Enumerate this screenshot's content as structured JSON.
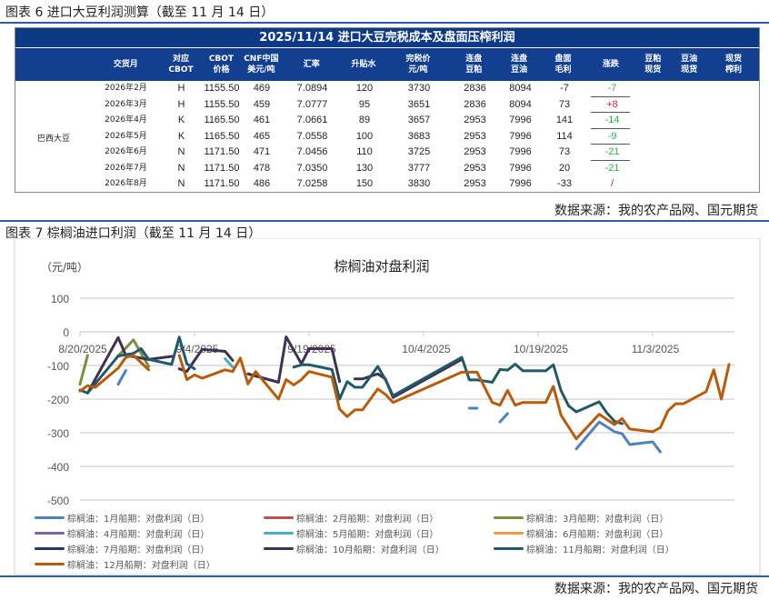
{
  "table_section": {
    "title": "图表 6 进口大豆利润测算（截至 11 月 14 日）",
    "source": "数据来源：我的农产品网、国元期货"
  },
  "table": {
    "title": "2025/11/14 进口大豆完税成本及盘面压榨利润",
    "headers": [
      "",
      "交货月",
      "对应\nCBOT",
      "CBOT\n价格",
      "CNF中国\n美元/吨",
      "汇率",
      "升贴水",
      "完税价\n元/吨",
      "连盘\n豆粕",
      "连盘\n豆油",
      "盘面\n毛利",
      "涨跌",
      "豆粕\n现货",
      "豆油\n现货",
      "现货\n榨利"
    ],
    "row_label": "巴西大豆",
    "rows": [
      {
        "month": "2026年2月",
        "cbot": "H",
        "price": "1155.50",
        "cnf": "469",
        "fx": "7.0894",
        "basis": "120",
        "duty": "3730",
        "meal": "2836",
        "oil": "8094",
        "margin": "-7",
        "change": "-7",
        "dir": "down"
      },
      {
        "month": "2026年3月",
        "cbot": "H",
        "price": "1155.50",
        "cnf": "459",
        "fx": "7.0777",
        "basis": "95",
        "duty": "3651",
        "meal": "2836",
        "oil": "8094",
        "margin": "73",
        "change": "+8",
        "dir": "up"
      },
      {
        "month": "2026年4月",
        "cbot": "K",
        "price": "1165.50",
        "cnf": "461",
        "fx": "7.0661",
        "basis": "89",
        "duty": "3657",
        "meal": "2953",
        "oil": "7996",
        "margin": "141",
        "change": "-14",
        "dir": "down"
      },
      {
        "month": "2026年5月",
        "cbot": "K",
        "price": "1165.50",
        "cnf": "465",
        "fx": "7.0558",
        "basis": "100",
        "duty": "3683",
        "meal": "2953",
        "oil": "7996",
        "margin": "114",
        "change": "-9",
        "dir": "down"
      },
      {
        "month": "2026年6月",
        "cbot": "N",
        "price": "1171.50",
        "cnf": "471",
        "fx": "7.0456",
        "basis": "110",
        "duty": "3725",
        "meal": "2953",
        "oil": "7996",
        "margin": "73",
        "change": "-21",
        "dir": "down"
      },
      {
        "month": "2026年7月",
        "cbot": "N",
        "price": "1171.50",
        "cnf": "478",
        "fx": "7.0350",
        "basis": "130",
        "duty": "3777",
        "meal": "2953",
        "oil": "7996",
        "margin": "20",
        "change": "-21",
        "dir": "down"
      },
      {
        "month": "2026年8月",
        "cbot": "N",
        "price": "1171.50",
        "cnf": "486",
        "fx": "7.0258",
        "basis": "150",
        "duty": "3830",
        "meal": "2953",
        "oil": "7996",
        "margin": "-33",
        "change": "/",
        "dir": "up"
      }
    ],
    "colors": {
      "up": "#E8202A",
      "down": "#2BB04A",
      "header": "#123F8F"
    }
  },
  "chart_section": {
    "title": "图表 7 棕榈油进口利润（截至 11 月 14 日）",
    "source": "数据来源：我的农产品网、国元期货"
  },
  "chart_data": {
    "type": "line",
    "title": "棕榈油对盘利润",
    "ylabel": "（元/吨）",
    "ylim": [
      -500,
      100
    ],
    "yticks": [
      "100",
      "0",
      "-100",
      "-200",
      "-300",
      "-400",
      "-500"
    ],
    "x_unit": "trading day index from 8/20/2025",
    "xlim": [
      0,
      86
    ],
    "xticks": [
      {
        "day": 0,
        "label": "8/20/2025"
      },
      {
        "day": 15,
        "label": "9/4/2025"
      },
      {
        "day": 30,
        "label": "9/19/2025"
      },
      {
        "day": 45,
        "label": "10/4/2025"
      },
      {
        "day": 60,
        "label": "10/19/2025"
      },
      {
        "day": 75,
        "label": "11/3/2025"
      }
    ],
    "grid": true,
    "legend_position": "bottom",
    "series": [
      {
        "name": "棕榈油：1月船期：对盘利润（日）",
        "color": "#4F81BD",
        "segments": [
          [
            [
              5,
              -156
            ],
            [
              6,
              -115
            ]
          ],
          [
            [
              51,
              -227
            ],
            [
              52,
              -227
            ]
          ],
          [
            [
              55,
              -268
            ],
            [
              56,
              -243
            ]
          ],
          [
            [
              65,
              -348
            ],
            [
              68,
              -268
            ],
            [
              70,
              -297
            ],
            [
              71,
              -303
            ],
            [
              72,
              -335
            ],
            [
              75,
              -327
            ],
            [
              76,
              -357
            ]
          ]
        ]
      },
      {
        "name": "棕榈油：2月船期：对盘利润（日）",
        "color": "#C0504D",
        "segments": []
      },
      {
        "name": "棕榈油：3月船期：对盘利润（日）",
        "color": "#76923C",
        "segments": [
          [
            [
              0,
              -156
            ],
            [
              1,
              -70
            ]
          ],
          [
            [
              5,
              -72
            ],
            [
              7,
              -24
            ],
            [
              9,
              -103
            ]
          ]
        ]
      },
      {
        "name": "棕榈油：4月船期：对盘利润（日）",
        "color": "#8064A2",
        "segments": []
      },
      {
        "name": "棕榈油：5月船期：对盘利润（日）",
        "color": "#4BACC6",
        "segments": [
          [
            [
              19,
              -80
            ],
            [
              20,
              -105
            ]
          ]
        ]
      },
      {
        "name": "棕榈油：6月船期：对盘利润（日）",
        "color": "#F79646",
        "segments": []
      },
      {
        "name": "棕榈油：7月船期：对盘利润（日）",
        "color": "#1F3864",
        "segments": []
      },
      {
        "name": "棕榈油：10月船期：对盘利润（日）",
        "color": "#403152",
        "segments": [
          [
            [
              1,
              -182
            ],
            [
              5,
              -17
            ],
            [
              6,
              -70
            ],
            [
              9,
              -82
            ],
            [
              12,
              -73
            ]
          ],
          [
            [
              13,
              -110
            ],
            [
              14,
              -118
            ],
            [
              16,
              -52
            ],
            [
              19,
              -58
            ],
            [
              20,
              -85
            ]
          ],
          [
            [
              22,
              -125
            ],
            [
              26,
              -150
            ],
            [
              27,
              -15
            ],
            [
              29,
              -95
            ],
            [
              30,
              -50
            ],
            [
              33,
              -50
            ],
            [
              34,
              -148
            ]
          ],
          [
            [
              36,
              -140
            ],
            [
              37,
              -140
            ],
            [
              39,
              -125
            ],
            [
              40,
              -140
            ],
            [
              41,
              -195
            ],
            [
              50,
              -82
            ]
          ]
        ]
      },
      {
        "name": "棕榈油：11月船期：对盘利润（日）",
        "color": "#215968",
        "segments": [
          [
            [
              0,
              -173
            ],
            [
              1,
              -182
            ],
            [
              5,
              -72
            ],
            [
              7,
              -64
            ],
            [
              8,
              -50
            ],
            [
              9,
              -82
            ],
            [
              12,
              -97
            ],
            [
              13,
              -16
            ],
            [
              14,
              -95
            ],
            [
              15,
              -110
            ]
          ],
          [
            [
              28,
              -105
            ],
            [
              29,
              -98
            ],
            [
              30,
              -98
            ],
            [
              33,
              -112
            ],
            [
              34,
              -200
            ],
            [
              35,
              -148
            ],
            [
              36,
              -165
            ],
            [
              37,
              -165
            ],
            [
              39,
              -103
            ],
            [
              40,
              -142
            ],
            [
              41,
              -190
            ],
            [
              50,
              -76
            ],
            [
              51,
              -143
            ],
            [
              52,
              -143
            ],
            [
              54,
              -150
            ],
            [
              55,
              -112
            ],
            [
              56,
              -114
            ],
            [
              57,
              -96
            ],
            [
              58,
              -116
            ],
            [
              61,
              -116
            ],
            [
              62,
              -98
            ],
            [
              63,
              -175
            ],
            [
              64,
              -220
            ],
            [
              65,
              -238
            ],
            [
              68,
              -208
            ],
            [
              69,
              -241
            ],
            [
              70,
              -266
            ],
            [
              71,
              -273
            ]
          ]
        ]
      },
      {
        "name": "棕榈油：12月船期：对盘利润（日）",
        "color": "#B85C0B",
        "segments": [
          [
            [
              0,
              -176
            ],
            [
              1,
              -160
            ],
            [
              2,
              -165
            ],
            [
              5,
              -108
            ],
            [
              6,
              -76
            ],
            [
              7,
              -70
            ],
            [
              9,
              -113
            ]
          ],
          [
            [
              13,
              -70
            ],
            [
              14,
              -142
            ],
            [
              15,
              -128
            ],
            [
              16,
              -138
            ],
            [
              19,
              -113
            ],
            [
              20,
              -118
            ],
            [
              21,
              -78
            ],
            [
              22,
              -155
            ],
            [
              23,
              -118
            ],
            [
              26,
              -200
            ],
            [
              27,
              -142
            ],
            [
              28,
              -158
            ],
            [
              29,
              -142
            ],
            [
              30,
              -118
            ],
            [
              33,
              -135
            ],
            [
              34,
              -230
            ],
            [
              35,
              -252
            ],
            [
              36,
              -232
            ],
            [
              37,
              -232
            ],
            [
              39,
              -170
            ],
            [
              40,
              -186
            ],
            [
              41,
              -210
            ],
            [
              50,
              -120
            ],
            [
              52,
              -120
            ],
            [
              54,
              -210
            ],
            [
              55,
              -218
            ],
            [
              56,
              -174
            ],
            [
              57,
              -218
            ],
            [
              58,
              -210
            ],
            [
              61,
              -210
            ],
            [
              62,
              -162
            ],
            [
              63,
              -248
            ],
            [
              65,
              -318
            ],
            [
              68,
              -245
            ],
            [
              70,
              -276
            ],
            [
              71,
              -258
            ],
            [
              72,
              -289
            ],
            [
              75,
              -297
            ],
            [
              76,
              -285
            ],
            [
              77,
              -235
            ],
            [
              78,
              -214
            ],
            [
              79,
              -214
            ],
            [
              82,
              -178
            ],
            [
              83,
              -113
            ],
            [
              84,
              -200
            ],
            [
              85,
              -97
            ]
          ]
        ]
      }
    ]
  }
}
